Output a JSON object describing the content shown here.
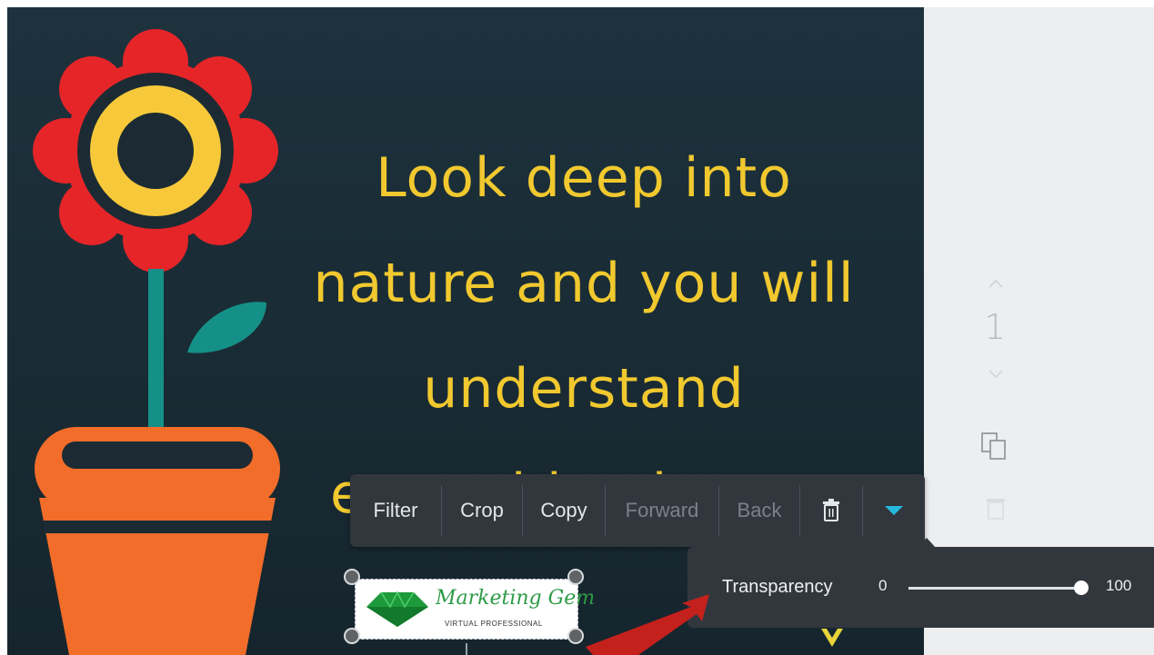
{
  "design": {
    "quote_lines": [
      "Look deep into",
      "nature and you will",
      "understand",
      "everything better."
    ],
    "logo": {
      "name": "Marketing Gem",
      "tagline": "VIRTUAL PROFESSIONAL"
    }
  },
  "toolbar": {
    "filter_label": "Filter",
    "crop_label": "Crop",
    "copy_label": "Copy",
    "forward_label": "Forward",
    "back_label": "Back"
  },
  "transparency": {
    "label": "Transparency",
    "min": "0",
    "max": "100",
    "value": 100
  },
  "sidebar": {
    "page_number": "1"
  },
  "colors": {
    "canvas_bg": "#1b2c35",
    "quote_text": "#f1c92f",
    "toolbar_bg": "#32373e",
    "accent": "#27b8dd",
    "annotation_arrow": "#c4201c"
  }
}
